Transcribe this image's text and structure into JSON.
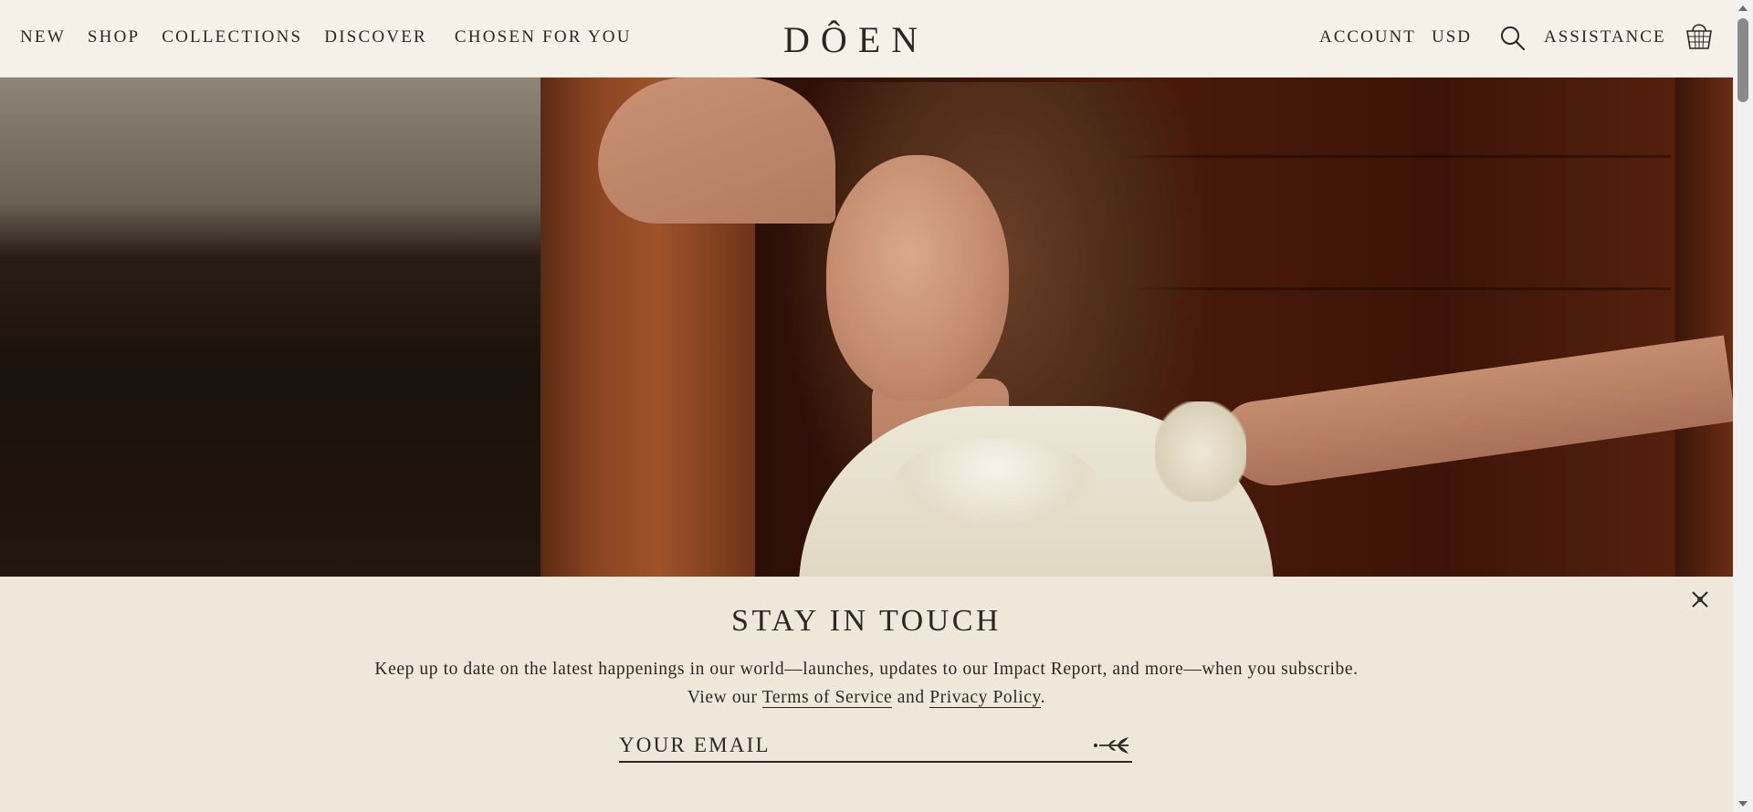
{
  "header": {
    "nav_left": [
      {
        "label": "NEW"
      },
      {
        "label": "SHOP"
      },
      {
        "label": "COLLECTIONS"
      },
      {
        "label": "DISCOVER"
      },
      {
        "label": "CHOSEN FOR YOU"
      }
    ],
    "logo": "DÔEN",
    "account_label": "ACCOUNT",
    "currency_label": "USD",
    "search_icon": "search-icon",
    "assistance_label": "ASSISTANCE",
    "bag_icon": "shopping-basket-icon"
  },
  "hero": {
    "image": "woman-in-cream-lace-dress-leaning-in-doorway"
  },
  "newsletter": {
    "title": "STAY IN TOUCH",
    "description": "Keep up to date on the latest happenings in our world—launches, updates to our Impact Report, and more—when you subscribe.",
    "view_our": "View our",
    "terms_link": "Terms of Service",
    "and": "and",
    "privacy_link": "Privacy Policy",
    "period": ".",
    "email_placeholder": "YOUR EMAIL",
    "close_icon": "close-icon",
    "submit_icon": "arrow-sprig-icon"
  },
  "colors": {
    "header_bg": "#f5f1e8",
    "newsletter_bg": "#efe7da",
    "text": "#2b2722"
  }
}
